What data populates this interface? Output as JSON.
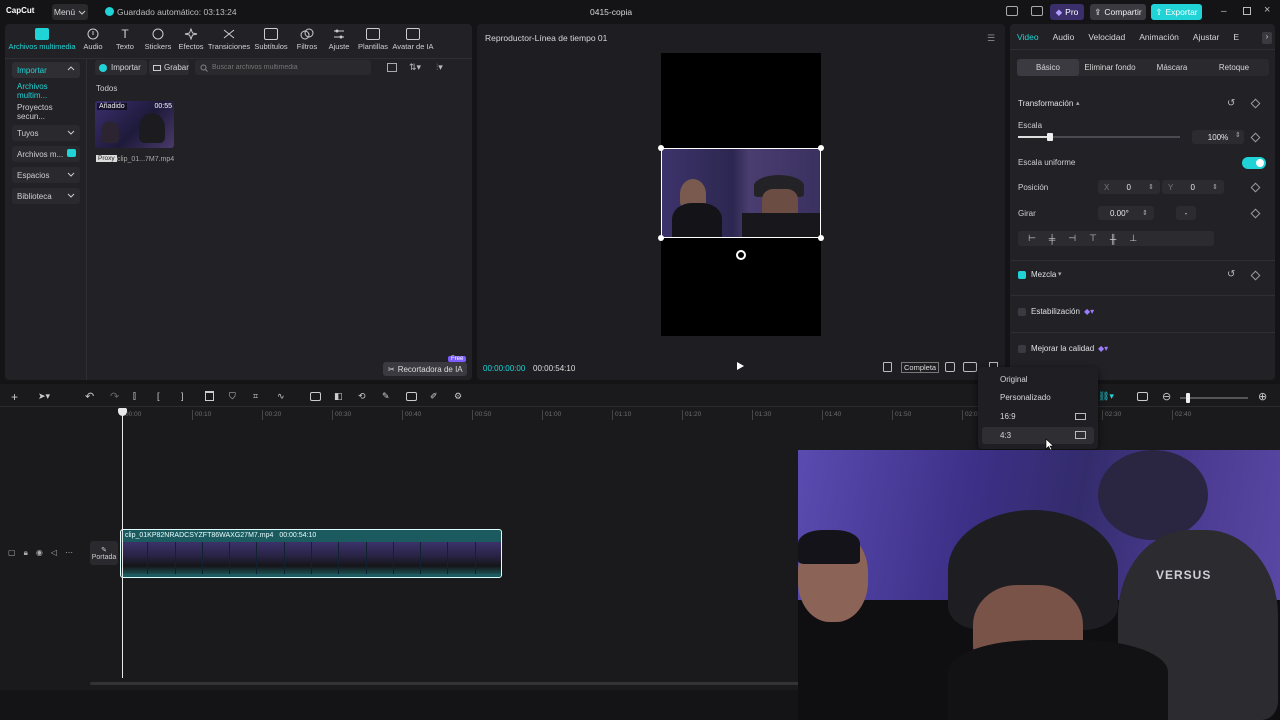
{
  "app": {
    "logo": "CapCut",
    "menu_label": "Menú",
    "autosave": "Guardado automático: 03:13:24",
    "project_name": "0415-copia",
    "pro_label": "Pro",
    "share_label": "Compartir",
    "export_label": "Exportar"
  },
  "toolbar": {
    "items": [
      {
        "label": "Archivos multimedia"
      },
      {
        "label": "Audio"
      },
      {
        "label": "Texto"
      },
      {
        "label": "Stickers"
      },
      {
        "label": "Efectos"
      },
      {
        "label": "Transiciones"
      },
      {
        "label": "Subtítulos"
      },
      {
        "label": "Filtros"
      },
      {
        "label": "Ajuste"
      },
      {
        "label": "Plantillas"
      },
      {
        "label": "Avatar de IA"
      }
    ]
  },
  "sidebar": {
    "items": [
      {
        "label": "Importar"
      },
      {
        "label": "Archivos multim..."
      },
      {
        "label": "Proyectos secun..."
      },
      {
        "label": "Tuyos"
      },
      {
        "label": "Archivos m..."
      },
      {
        "label": "Espacios"
      },
      {
        "label": "Biblioteca"
      }
    ]
  },
  "media": {
    "import_label": "Importar",
    "record_label": "Grabar",
    "search_placeholder": "Buscar archivos multimedia",
    "filter_label": "Todos",
    "clip": {
      "badge": "Añadido",
      "duration": "00:55",
      "proxy": "Proxy",
      "name": "clip_01...7M7.mp4"
    },
    "ai_cutout_label": "Recortadora de IA",
    "free_badge": "Free"
  },
  "player": {
    "title": "Reproductor-Línea de tiempo 01",
    "current_time": "00:00:00:00",
    "total_time": "00:00:54:10",
    "complete_label": "Completa"
  },
  "inspector": {
    "tabs": [
      {
        "label": "Video"
      },
      {
        "label": "Audio"
      },
      {
        "label": "Velocidad"
      },
      {
        "label": "Animación"
      },
      {
        "label": "Ajustar"
      },
      {
        "label": "E"
      }
    ],
    "subtabs": [
      {
        "label": "Básico"
      },
      {
        "label": "Eliminar fondo"
      },
      {
        "label": "Máscara"
      },
      {
        "label": "Retoque"
      }
    ],
    "transform_label": "Transformación",
    "scale_label": "Escala",
    "scale_value": "100%",
    "scale_fraction": 0.2,
    "uniform_label": "Escala uniforme",
    "position_label": "Posición",
    "pos_x_label": "X",
    "pos_x": "0",
    "pos_y_label": "Y",
    "pos_y": "0",
    "rotate_label": "Girar",
    "rotate_value": "0.00°",
    "rotate_dash": "-",
    "blend_label": "Mezcla",
    "stabilize_label": "Estabilización",
    "enhance_label": "Mejorar la calidad"
  },
  "ratio_menu": {
    "items": [
      {
        "label": "Original"
      },
      {
        "label": "Personalizado"
      },
      {
        "label": "16:9"
      },
      {
        "label": "4:3"
      }
    ]
  },
  "timeline": {
    "ticks": [
      "00:00",
      "00:10",
      "00:20",
      "00:30",
      "00:40",
      "00:50",
      "01:00",
      "01:10",
      "01:20",
      "01:30",
      "01:40",
      "01:50",
      "02:0",
      "02:20",
      "02:30",
      "02:40"
    ],
    "cover_label": "Portada",
    "clip_name": "clip_01KP82NRADCSYZFT86WAXG27M7.mp4",
    "clip_duration": "00:00:54:10"
  },
  "colors": {
    "accent": "#1fd3d6",
    "background": "#141416",
    "panel": "#222226"
  }
}
